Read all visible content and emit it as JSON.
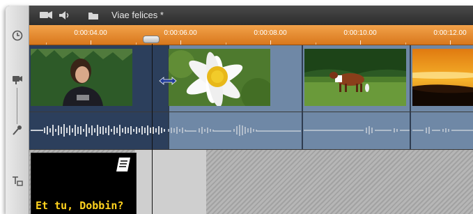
{
  "project": {
    "title": "Viae felices *"
  },
  "ruler": {
    "ticks": [
      "0:00:04.00",
      "0:00:06.00",
      "0:00:08.00",
      "0:00:10.00",
      "0:00:12.00"
    ]
  },
  "title_clip": {
    "text": "Et tu, Dobbin?"
  },
  "icons": {
    "left": [
      "clock-icon",
      "camera-track-icon",
      "microphone-icon",
      "title-track-icon"
    ],
    "toolbar": [
      "camera-icon",
      "speaker-icon",
      "folder-icon"
    ],
    "trim_cursor": "double-arrow-icon",
    "title_clip_badge": "title-document-icon"
  },
  "colors": {
    "ruler": "#e88a2e",
    "track_bg": "#6f88a6",
    "title_text": "#ffd21e"
  }
}
